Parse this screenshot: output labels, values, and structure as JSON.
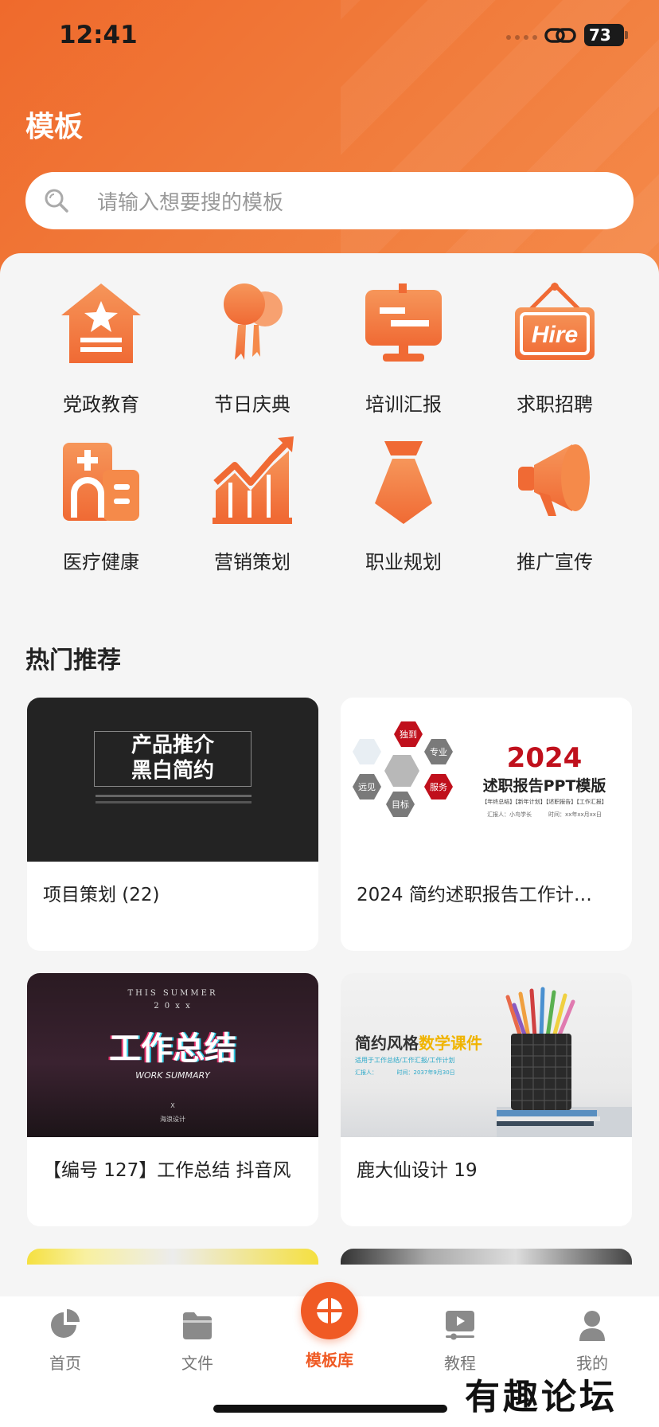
{
  "status": {
    "time": "12:41",
    "battery": "73"
  },
  "header": {
    "title": "模板",
    "search_placeholder": "请输入想要搜的模板"
  },
  "categories": [
    {
      "label": "党政教育",
      "icon": "party-building-icon"
    },
    {
      "label": "节日庆典",
      "icon": "balloon-ribbon-icon"
    },
    {
      "label": "培训汇报",
      "icon": "presentation-board-icon"
    },
    {
      "label": "求职招聘",
      "icon": "hire-sign-icon",
      "icon_text": "Hire"
    },
    {
      "label": "医疗健康",
      "icon": "hospital-icon"
    },
    {
      "label": "营销策划",
      "icon": "growth-chart-icon"
    },
    {
      "label": "职业规划",
      "icon": "necktie-icon"
    },
    {
      "label": "推广宣传",
      "icon": "megaphone-icon"
    }
  ],
  "section": {
    "title": "热门推荐"
  },
  "cards": [
    {
      "caption": "项目策划 (22)",
      "thumb_title_1": "产品推介",
      "thumb_title_2": "黑白简约"
    },
    {
      "caption": "2024 简约述职报告工作计…",
      "thumb_year": "2024",
      "thumb_title": "述职报告PPT模版",
      "thumb_subtitle": "【年终总结】【新年计划】【述职报告】【工作汇报】",
      "thumb_meta": "汇报人：小鸟学长　　　时间：xx年xx月xx日",
      "hex_labels": [
        "独到",
        "专业",
        "远见",
        "服务",
        "目标"
      ]
    },
    {
      "caption": "【编号 127】工作总结 抖音风",
      "thumb_top": "THIS SUMMER",
      "thumb_year": "2 0 x x",
      "thumb_title": "工作总结",
      "thumb_sub": "WORK SUMMARY",
      "thumb_x": "X",
      "thumb_brand": "海浪设计"
    },
    {
      "caption": "鹿大仙设计 19",
      "thumb_title_a": "简约风格",
      "thumb_title_b": "数学课件",
      "thumb_sub": "适用于工作总结/工作汇报/工作计划",
      "thumb_meta": "汇报人：　　　　时间：2037年9月30日"
    }
  ],
  "tabs": [
    {
      "label": "首页",
      "icon": "pie-chart-icon"
    },
    {
      "label": "文件",
      "icon": "folder-icon"
    },
    {
      "label": "模板库",
      "icon": "template-grid-icon",
      "active": true
    },
    {
      "label": "教程",
      "icon": "video-tutorial-icon"
    },
    {
      "label": "我的",
      "icon": "user-icon"
    }
  ],
  "watermark": "有趣论坛",
  "colors": {
    "accent": "#f05a24",
    "header": "#ef6a2c",
    "icon_orange": "#f47a3c"
  }
}
